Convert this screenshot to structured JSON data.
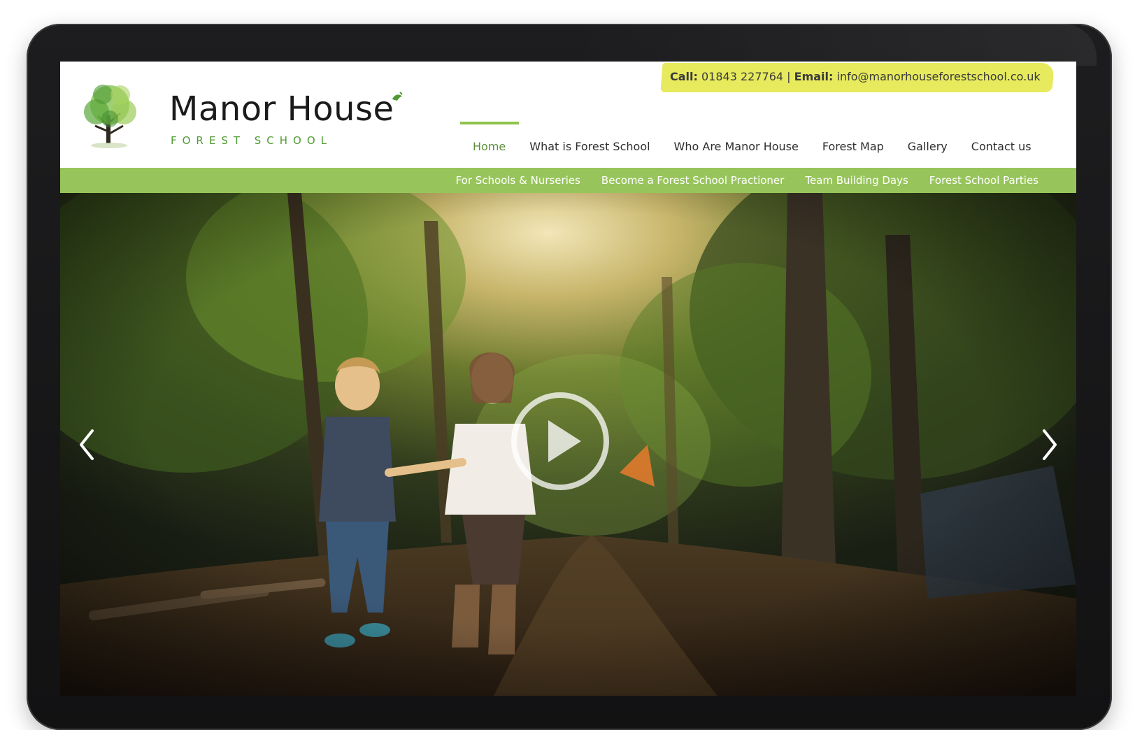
{
  "header": {
    "logo": {
      "title": "Manor House",
      "subtitle": "FOREST SCHOOL"
    },
    "contact": {
      "call_label": "Call:",
      "phone": "01843 227764",
      "separator": "|",
      "email_label": "Email:",
      "email": "info@manorhouseforestschool.co.uk"
    }
  },
  "nav": {
    "main": [
      {
        "label": "Home",
        "active": true
      },
      {
        "label": "What is Forest School"
      },
      {
        "label": "Who Are Manor House"
      },
      {
        "label": "Forest Map"
      },
      {
        "label": "Gallery"
      },
      {
        "label": "Contact us"
      }
    ],
    "sub": [
      {
        "label": "For Schools & Nurseries"
      },
      {
        "label": "Become a Forest School Practioner"
      },
      {
        "label": "Team Building Days"
      },
      {
        "label": "Forest School Parties"
      }
    ]
  },
  "hero": {
    "prev_icon": "chevron-left-icon",
    "next_icon": "chevron-right-icon",
    "play_icon": "play-icon"
  },
  "colors": {
    "accent_green": "#98c55b",
    "contact_yellow": "#e6ea5c",
    "logo_green": "#4f9b32"
  }
}
